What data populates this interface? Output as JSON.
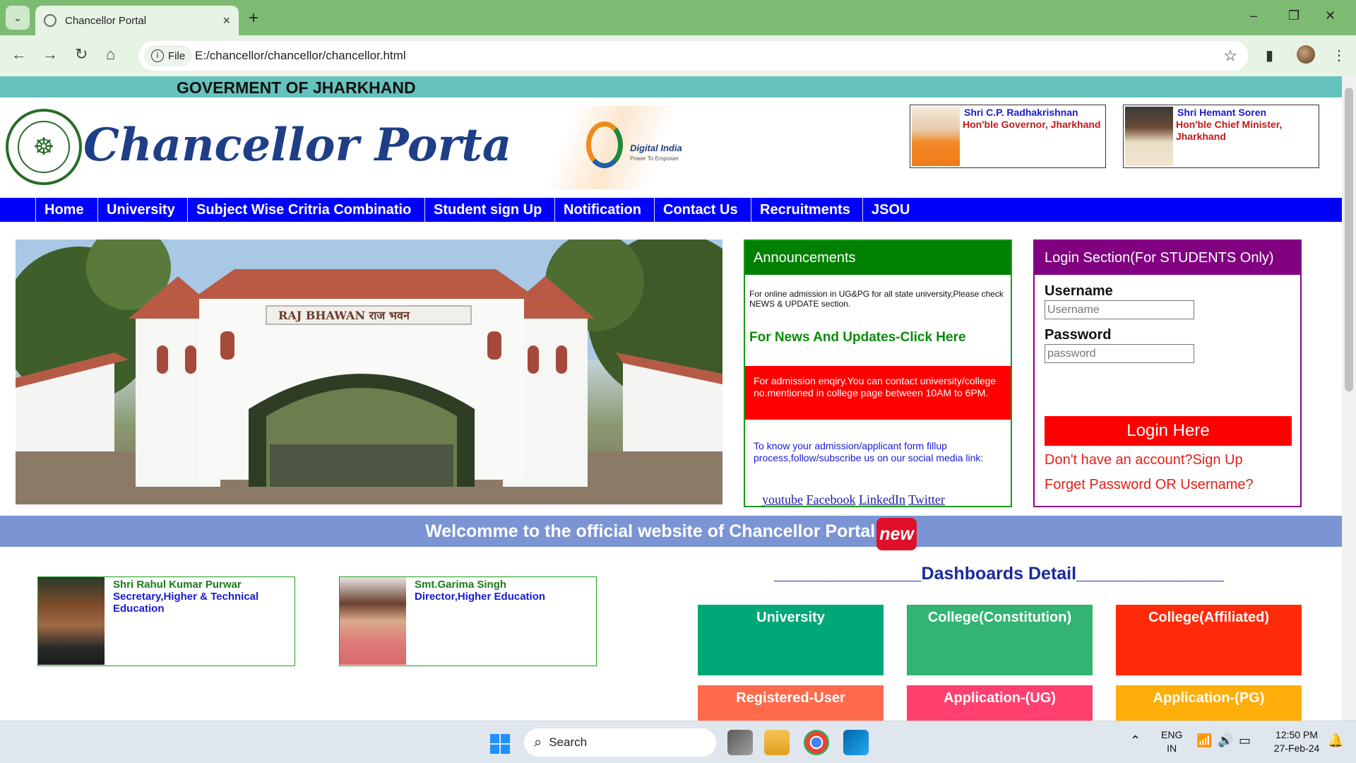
{
  "browser": {
    "tab_title": "Chancellor Portal",
    "tab_close": "×",
    "new_tab": "+",
    "site_chip": "File",
    "url": "E:/chancellor/chancellor/chancellor.html",
    "window_controls": [
      "–",
      "❐",
      "✕"
    ]
  },
  "header": {
    "gov_title": "GOVERMENT OF JHARKHAND",
    "portal_title": "Chancellor Portal",
    "digital_india": {
      "title": "Digital India",
      "subtitle": "Power To Empower"
    },
    "dignitaries": [
      {
        "name": "Shri C.P. Radhakrishnan",
        "role": "Hon'ble Governor, Jharkhand"
      },
      {
        "name": "Shri Hemant Soren",
        "role": "Hon'ble Chief Minister, Jharkhand"
      }
    ]
  },
  "nav": {
    "items": [
      "Home",
      "University",
      "Subject Wise Critria Combinatio",
      "Student sign Up",
      "Notification",
      "Contact Us",
      "Recruitments",
      "JSOU"
    ]
  },
  "banner": {
    "gate_sign": "RAJ BHAWAN राज भवन"
  },
  "announcements": {
    "title": "Announcements",
    "notice1": "For online admission in UG&PG for all state university,Please check NEWS & UPDATE section.",
    "news_link": "For News And Updates-Click Here",
    "notice2": "For admission enqiry.You can contact university/college no.mentioned in college page between 10AM to 6PM.",
    "notice3": "To know your admission/applicant form fillup process,follow/subscribe us on our social media link:",
    "social": [
      "youtube",
      "Facebook",
      "LinkedIn",
      "Twitter"
    ]
  },
  "login": {
    "title": "Login Section(For STUDENTS Only)",
    "username_label": "Username",
    "username_placeholder": "Username",
    "password_label": "Password",
    "password_placeholder": "password",
    "login_button": "Login Here",
    "signup_link": "Don't have an account?Sign Up",
    "forgot_link": "Forget Password OR Username?"
  },
  "welcome": {
    "text": "Welcomme to the official website of Chancellor Portal",
    "badge": "new"
  },
  "officials": [
    {
      "name": "Shri Rahul Kumar Purwar",
      "role": "Secretary,Higher & Technical Education"
    },
    {
      "name": "Smt.Garima Singh",
      "role": "Director,Higher Education"
    }
  ],
  "dashboards": {
    "title": "_______________Dashboards Detail_______________",
    "tiles": [
      {
        "label": "University",
        "color": "#00a877"
      },
      {
        "label": "College(Constitution)",
        "color": "#33b473"
      },
      {
        "label": "College(Affiliated)",
        "color": "#ff2a0a"
      },
      {
        "label": "Registered-User",
        "color": "#ff6a4d"
      },
      {
        "label": "Application-(UG)",
        "color": "#ff3f6e"
      },
      {
        "label": "Application-(PG)",
        "color": "#ffae0a"
      }
    ]
  },
  "taskbar": {
    "search_label": "Search",
    "lang_top": "ENG",
    "lang_bottom": "IN",
    "time": "12:50 PM",
    "date": "27-Feb-24"
  },
  "colors": {
    "nav_bg": "#0000ff",
    "gov_strip": "#66c2bd",
    "announce_green": "#008000",
    "login_purple": "#800080",
    "alert_red": "#ff0000"
  }
}
